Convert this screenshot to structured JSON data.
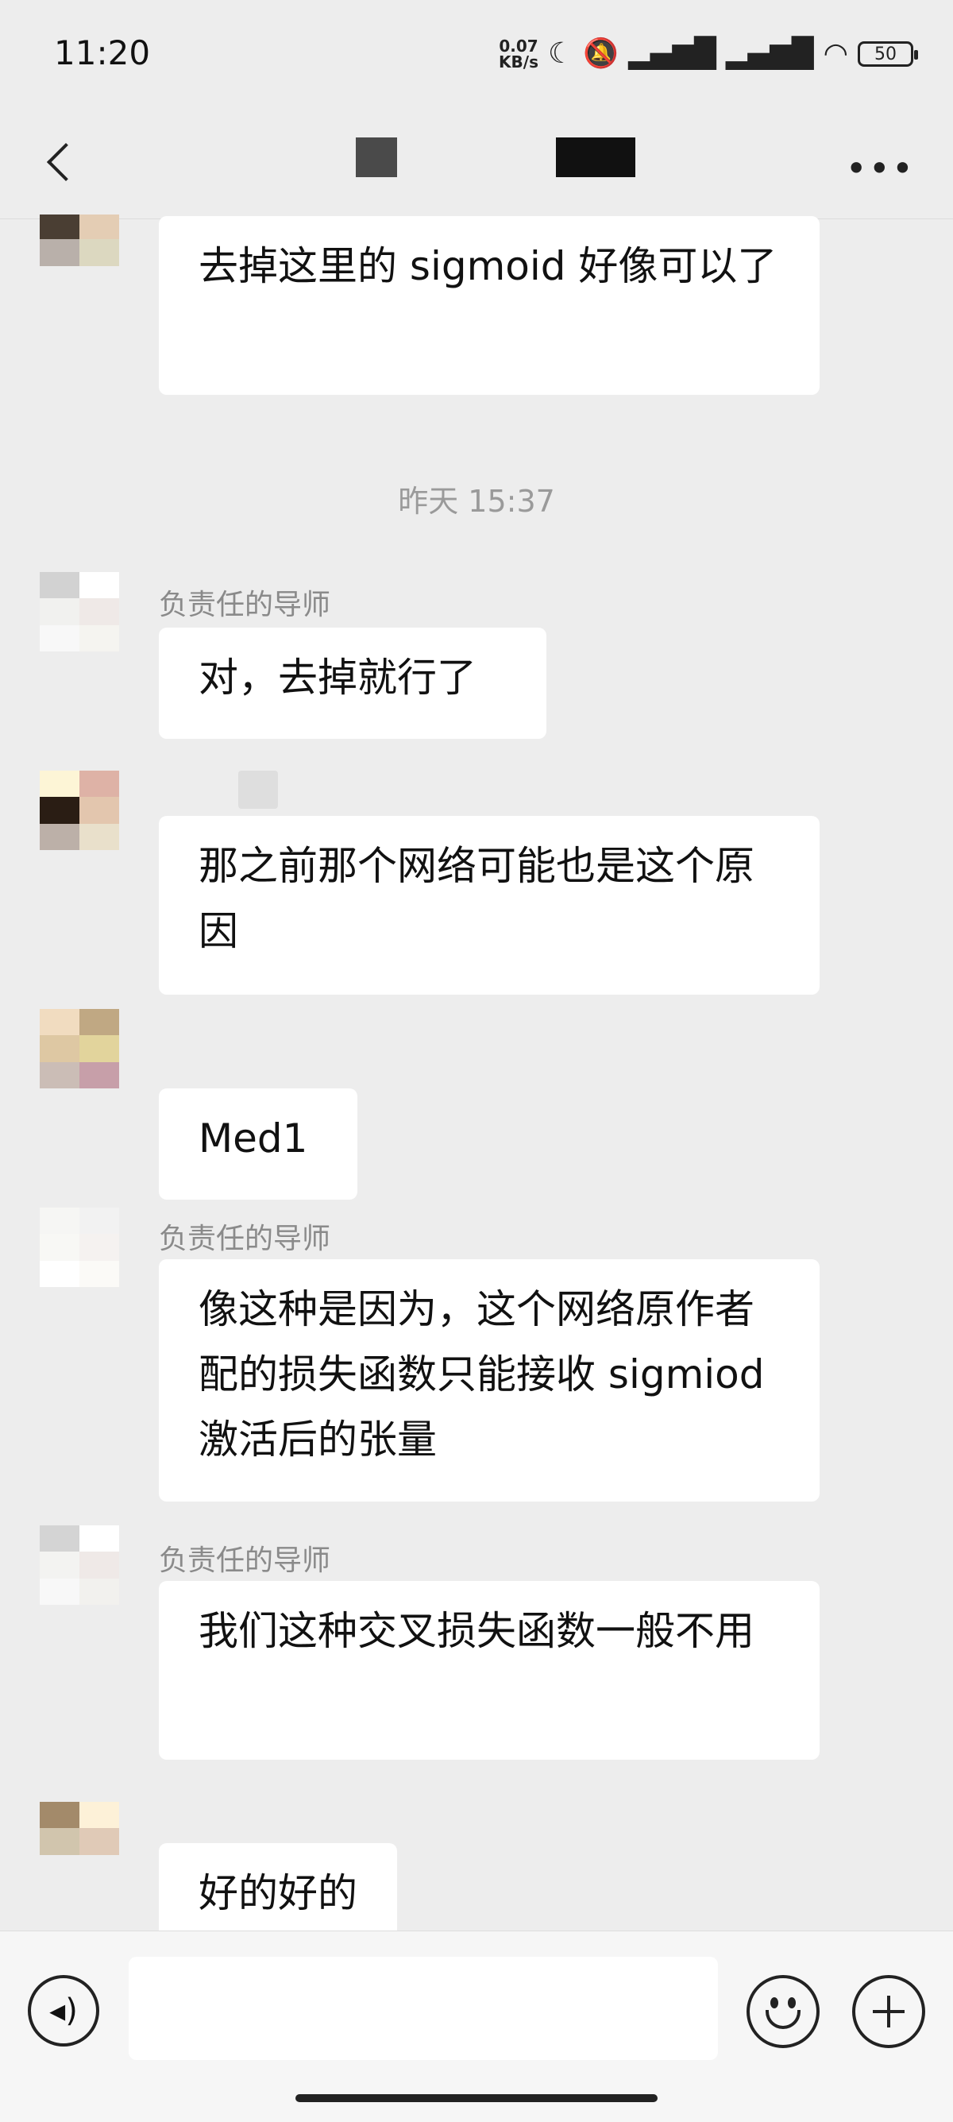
{
  "status_bar": {
    "time": "11:20",
    "net_speed_value": "0.07",
    "net_speed_unit": "KB/s",
    "battery": "50"
  },
  "nav": {
    "more_icon": "more-icon"
  },
  "chat": {
    "timestamp": "昨天 15:37",
    "messages": [
      {
        "text": "去掉这里的 sigmoid 好像可以了"
      },
      {
        "sender": "负责任的导师",
        "text": "对，去掉就行了"
      },
      {
        "text": "那之前那个网络可能也是这个原因"
      },
      {
        "text": "Med1"
      },
      {
        "sender": "负责任的导师",
        "text": "像这种是因为，这个网络原作者配的损失函数只能接收 sigmiod 激活后的张量"
      },
      {
        "sender": "负责任的导师",
        "text": "我们这种交叉损失函数一般不用"
      },
      {
        "text": "好的好的"
      }
    ]
  },
  "input_bar": {
    "placeholder": "",
    "icons": [
      "voice-icon",
      "emoji-icon",
      "plus-icon"
    ]
  },
  "colors": {
    "background": "#ededed",
    "bubble": "#ffffff",
    "timestamp": "#9a9a9a"
  }
}
